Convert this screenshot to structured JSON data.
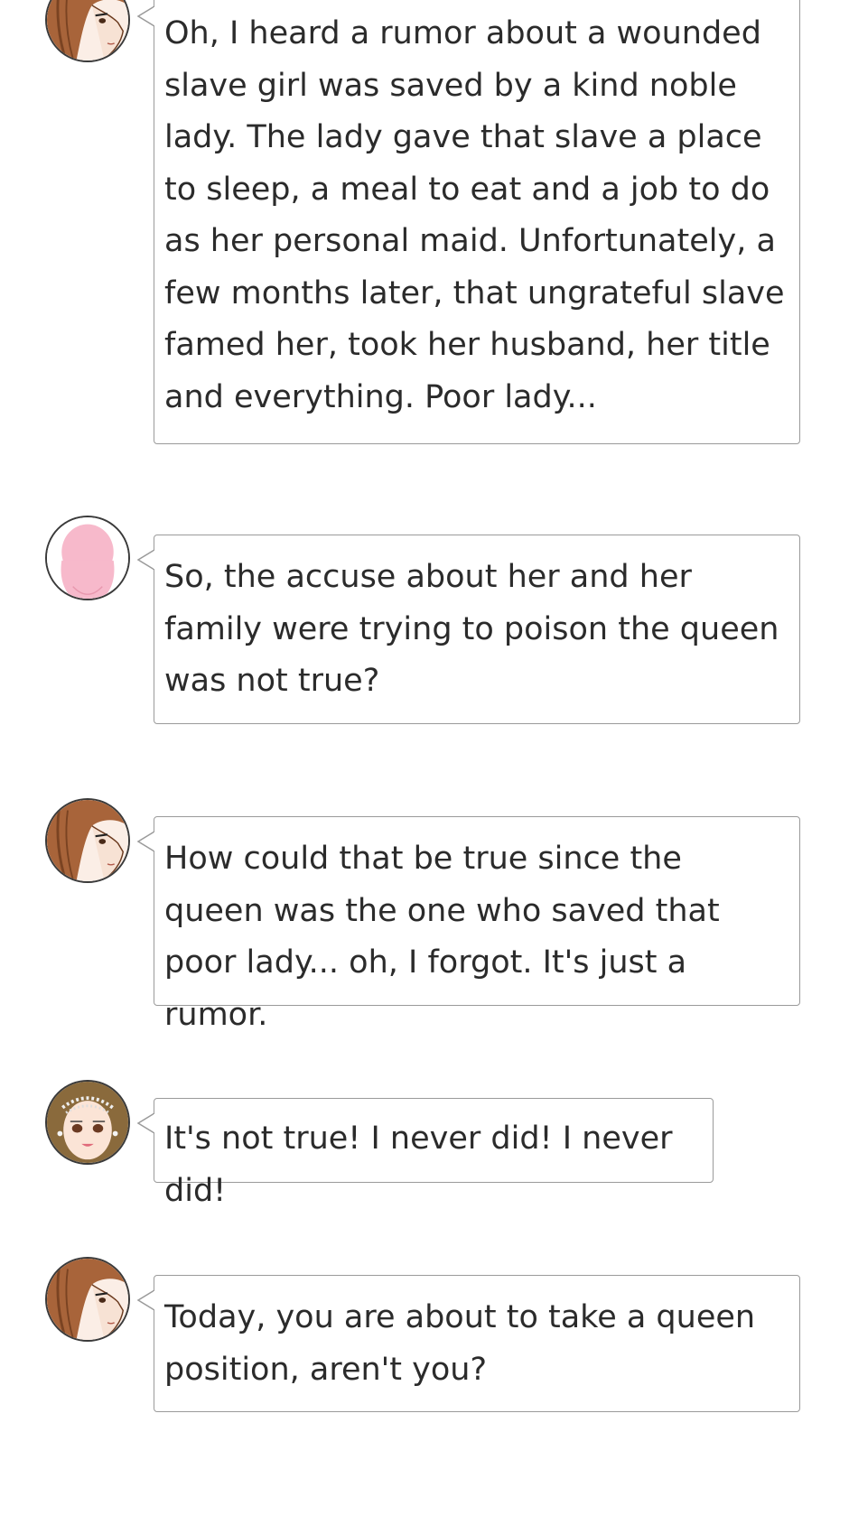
{
  "messages": [
    {
      "speaker": "brunette-servant",
      "text": "Oh, I heard a rumor about a wounded slave girl was saved by a kind noble lady. The lady gave that slave a place to sleep, a meal to eat and a job to do as her personal maid. Unfortunately, a few months later, that ungrateful slave famed her, took her husband, her title and everything. Poor lady..."
    },
    {
      "speaker": "pink-silhouette",
      "text": "So, the accuse about her and her family were trying to poison the queen was not true?"
    },
    {
      "speaker": "brunette-servant",
      "text": "How could that be true since the queen was the one who saved that poor lady... oh, I forgot. It's just a rumor."
    },
    {
      "speaker": "crowned-lady",
      "text": "It's not true! I never did! I never did!"
    },
    {
      "speaker": "brunette-servant",
      "text": "Today, you are about to take a queen position, aren't you?"
    }
  ]
}
